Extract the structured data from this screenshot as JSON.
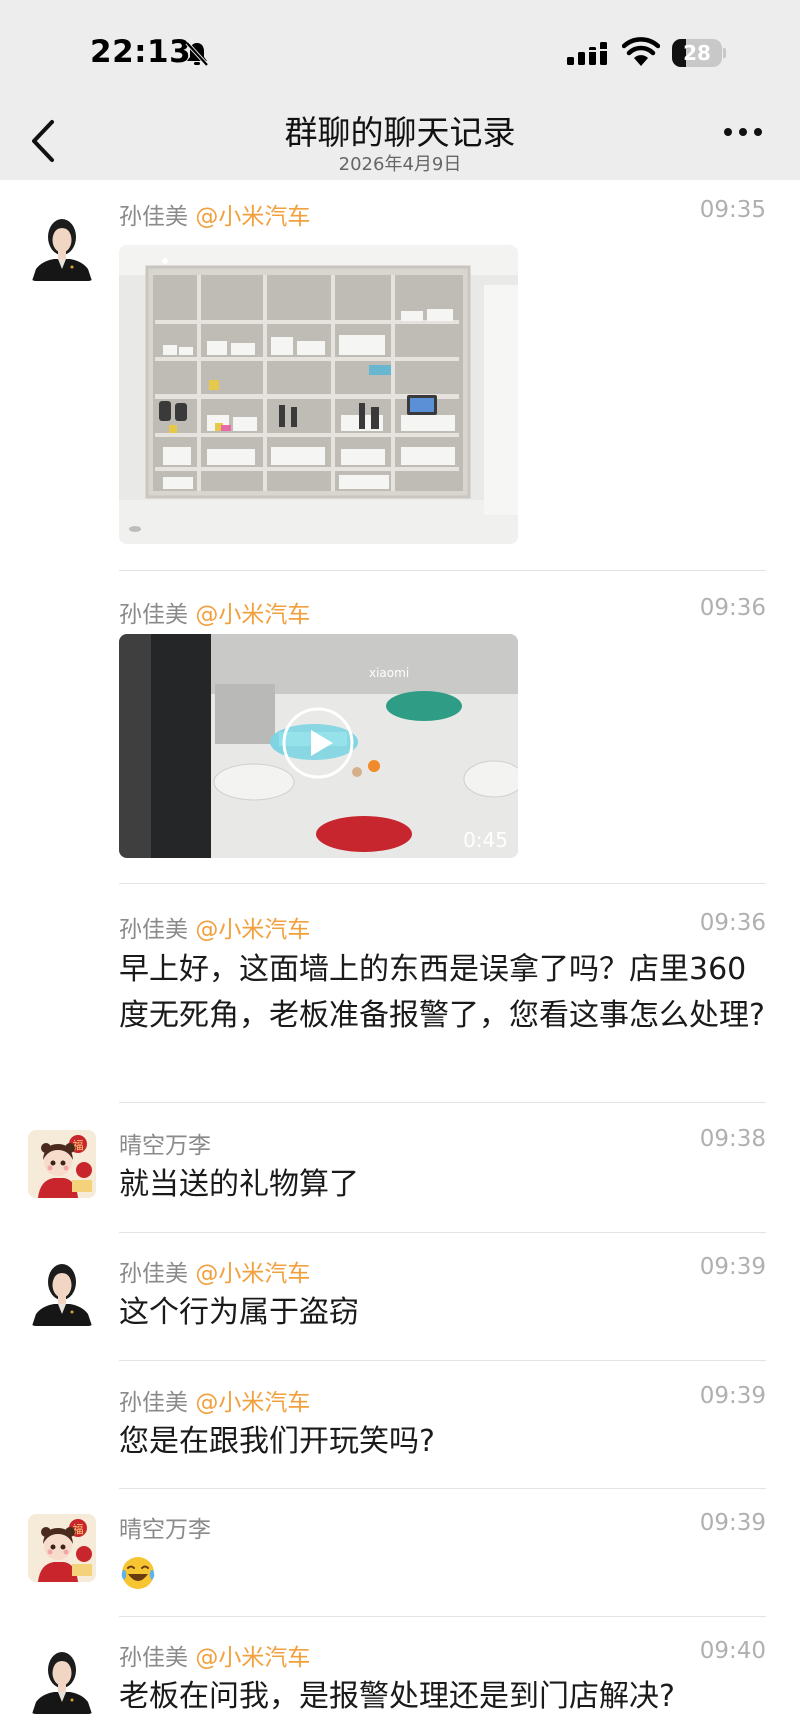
{
  "status_bar": {
    "time": "22:13",
    "battery": "28",
    "battery_level": 0.28
  },
  "nav": {
    "title": "群聊的聊天记录",
    "subtitle": "2026年4月9日"
  },
  "messages": [
    {
      "sender": "孙佳美",
      "mention": "@小米汽车",
      "time": "09:35",
      "type": "image"
    },
    {
      "sender": "孙佳美",
      "mention": "@小米汽车",
      "time": "09:36",
      "type": "video",
      "duration": "0:45",
      "watermark": "xiaomi"
    },
    {
      "sender": "孙佳美",
      "mention": "@小米汽车",
      "time": "09:36",
      "type": "text",
      "text": "早上好，这面墙上的东西是误拿了吗？店里360 度无死角，老板准备报警了，您看这事怎么处理?"
    },
    {
      "sender": "晴空万李",
      "mention": "",
      "time": "09:38",
      "type": "text",
      "text": "就当送的礼物算了"
    },
    {
      "sender": "孙佳美",
      "mention": "@小米汽车",
      "time": "09:39",
      "type": "text",
      "text": "这个行为属于盗窃"
    },
    {
      "sender": "孙佳美",
      "mention": "@小米汽车",
      "time": "09:39",
      "type": "text",
      "text": "您是在跟我们开玩笑吗?"
    },
    {
      "sender": "晴空万李",
      "mention": "",
      "time": "09:39",
      "type": "emoji",
      "emoji": "laughing-crying-emoji"
    },
    {
      "sender": "孙佳美",
      "mention": "@小米汽车",
      "time": "09:40",
      "type": "text",
      "text": "老板在问我，是报警处理还是到门店解决?"
    }
  ],
  "colors": {
    "mention": "#f2a03d",
    "header_bg": "#ededed",
    "time": "#b0b0b0"
  }
}
